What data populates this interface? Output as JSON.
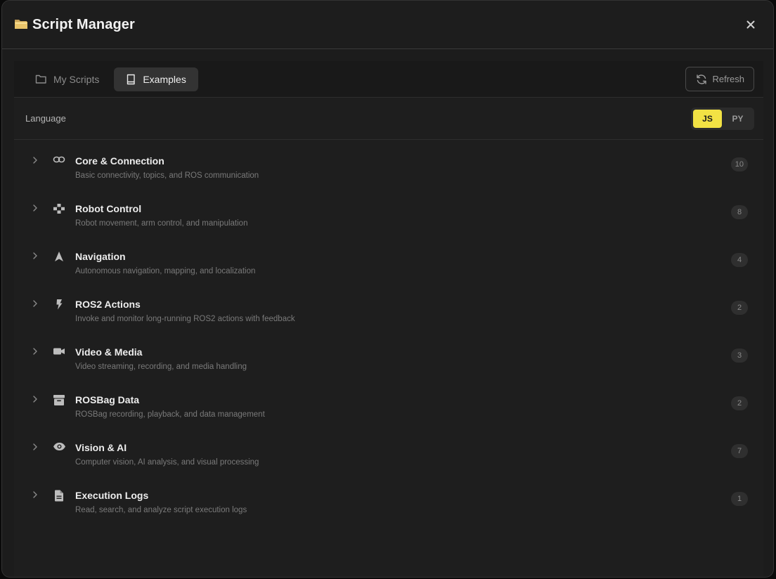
{
  "header": {
    "title": "Script Manager",
    "title_icon": "folder-icon",
    "close_label": "✕"
  },
  "tabs": [
    {
      "label": "My Scripts",
      "icon": "folder-outline-icon",
      "active": false
    },
    {
      "label": "Examples",
      "icon": "book-icon",
      "active": true
    }
  ],
  "refresh_label": "Refresh",
  "language": {
    "label": "Language",
    "options": [
      {
        "label": "JS",
        "active": true
      },
      {
        "label": "PY",
        "active": false
      }
    ]
  },
  "categories": [
    {
      "title": "Core & Connection",
      "desc": "Basic connectivity, topics, and ROS communication",
      "count": "10",
      "icon": "link-icon"
    },
    {
      "title": "Robot Control",
      "desc": "Robot movement, arm control, and manipulation",
      "count": "8",
      "icon": "gamepad-icon"
    },
    {
      "title": "Navigation",
      "desc": "Autonomous navigation, mapping, and localization",
      "count": "4",
      "icon": "navigation-arrow-icon"
    },
    {
      "title": "ROS2 Actions",
      "desc": "Invoke and monitor long-running ROS2 actions with feedback",
      "count": "2",
      "icon": "lightning-icon"
    },
    {
      "title": "Video & Media",
      "desc": "Video streaming, recording, and media handling",
      "count": "3",
      "icon": "video-camera-icon"
    },
    {
      "title": "ROSBag Data",
      "desc": "ROSBag recording, playback, and data management",
      "count": "2",
      "icon": "archive-box-icon"
    },
    {
      "title": "Vision & AI",
      "desc": "Computer vision, AI analysis, and visual processing",
      "count": "7",
      "icon": "eye-icon"
    },
    {
      "title": "Execution Logs",
      "desc": "Read, search, and analyze script execution logs",
      "count": "1",
      "icon": "document-icon"
    }
  ],
  "colors": {
    "accent": "#f2e244",
    "background": "#1c1c1c"
  }
}
